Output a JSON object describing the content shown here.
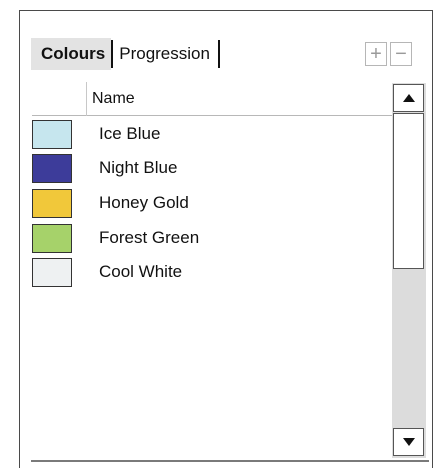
{
  "tabs": [
    {
      "label": "Colours",
      "active": true
    },
    {
      "label": "Progression",
      "active": false
    }
  ],
  "toolbar": {
    "add_label": "+",
    "remove_label": "−"
  },
  "table": {
    "column_header": "Name",
    "rows": [
      {
        "name": "Ice Blue",
        "color": "#c6e6ee"
      },
      {
        "name": "Night Blue",
        "color": "#3d3c9a"
      },
      {
        "name": "Honey Gold",
        "color": "#f1c83a"
      },
      {
        "name": "Forest Green",
        "color": "#a6d26a"
      },
      {
        "name": "Cool White",
        "color": "#eef1f2"
      }
    ]
  },
  "scrollbar": {
    "up_icon": "arrow-up-icon",
    "down_icon": "arrow-down-icon"
  }
}
